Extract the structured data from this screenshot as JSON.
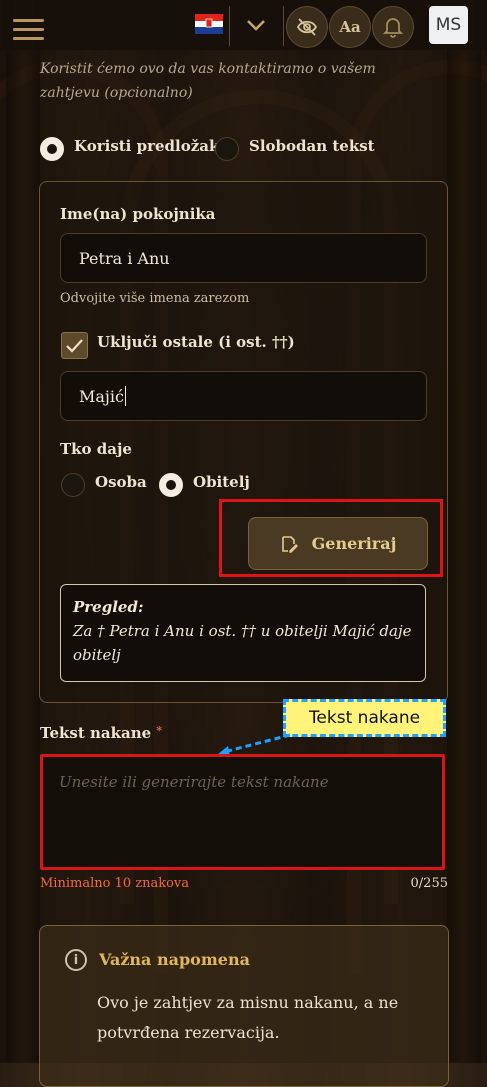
{
  "header": {
    "font_size_button": "Aa",
    "avatar_initials": "MS"
  },
  "contact_hint": "Koristit ćemo ovo da vas kontaktiramo o vašem zahtjevu (opcionalno)",
  "mode": {
    "options": [
      "Koristi predložak",
      "Slobodan tekst"
    ],
    "selected": "Koristi predložak"
  },
  "template": {
    "names_label": "Ime(na) pokojnika",
    "names_value": "Petra i Anu",
    "names_hint": "Odvojite više imena zarezom",
    "include_others_label": "Uključi ostale (i ost. ††)",
    "include_others_checked": true,
    "surname_value": "Majić",
    "giver_label": "Tko daje",
    "giver_options": [
      "Osoba",
      "Obitelj"
    ],
    "giver_selected": "Obitelj",
    "generate_label": "Generiraj",
    "preview_title": "Pregled:",
    "preview_text": "Za † Petra i Anu i ost. †† u obitelji Majić daje obitelj"
  },
  "intention": {
    "label": "Tekst nakane",
    "required_mark": "*",
    "placeholder": "Unesite ili generirajte tekst nakane",
    "min_hint": "Minimalno 10 znakova",
    "counter": "0/255",
    "annotation": "Tekst nakane"
  },
  "note": {
    "title": "Važna napomena",
    "text": "Ovo je zahtjev za misnu nakanu, a ne potvrđena rezervacija."
  },
  "colors": {
    "accent_gold": "#e0b859",
    "error_red": "#f26b3a",
    "highlight_red": "#e01414",
    "callout_blue": "#1fa2ff",
    "callout_yellow": "#fff37a"
  }
}
